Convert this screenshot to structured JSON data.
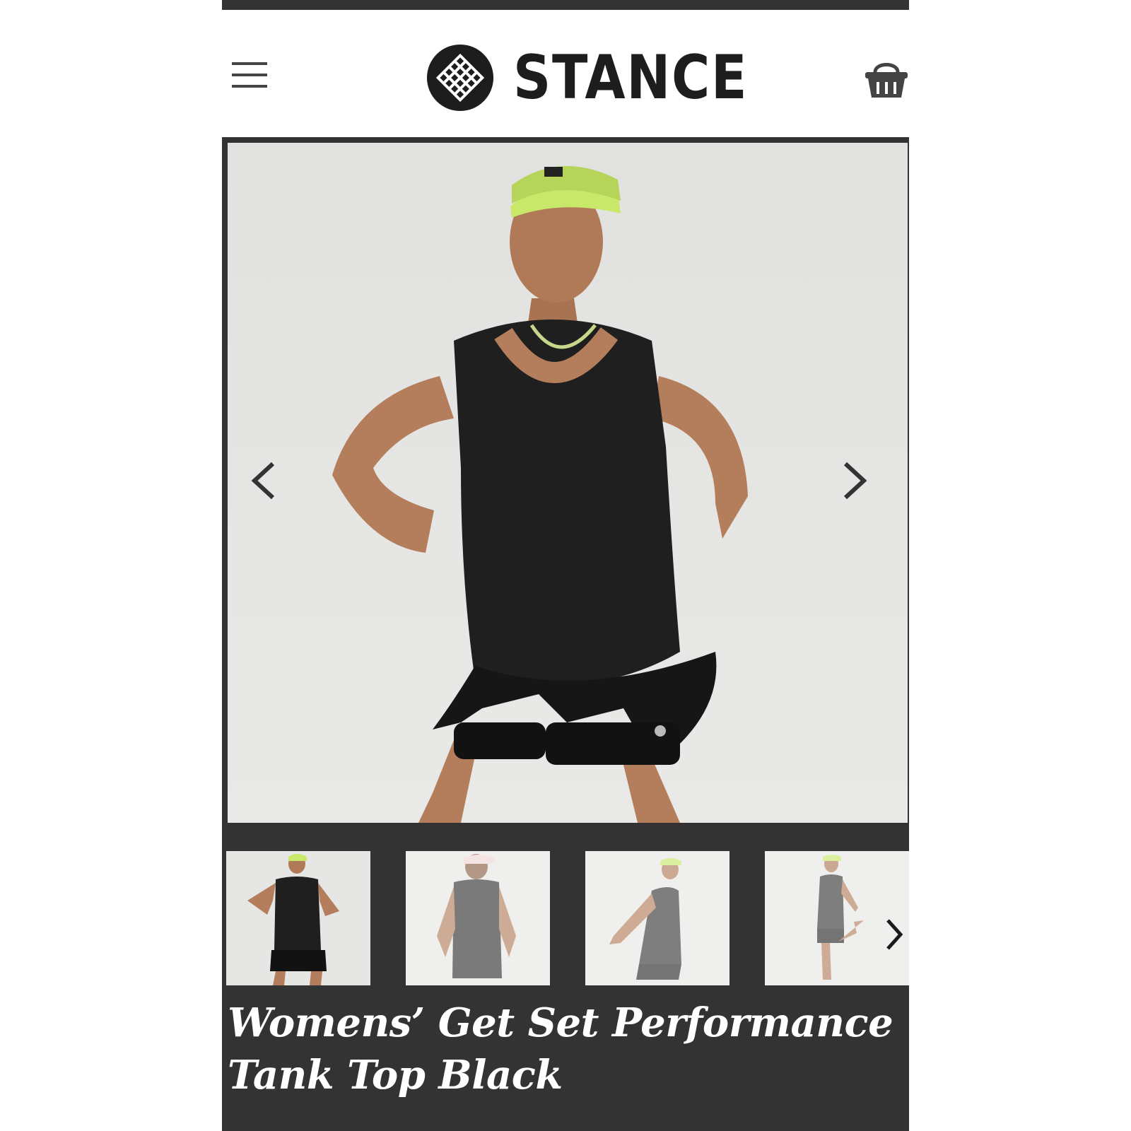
{
  "header": {
    "brand": "STANCE",
    "menu_icon": "hamburger-menu-icon",
    "cart_icon": "shopping-basket-icon"
  },
  "gallery": {
    "prev_icon": "chevron-left-icon",
    "next_icon": "chevron-right-icon",
    "thumbnail_count": 4,
    "selected_thumbnail": 1
  },
  "product": {
    "title": "Womens’ Get Set Performance Tank Top Black"
  },
  "colors": {
    "dark_panel": "#333333",
    "top_strip": "#333333",
    "title_text": "#ffffff",
    "cap_green": "#c8e86a"
  }
}
